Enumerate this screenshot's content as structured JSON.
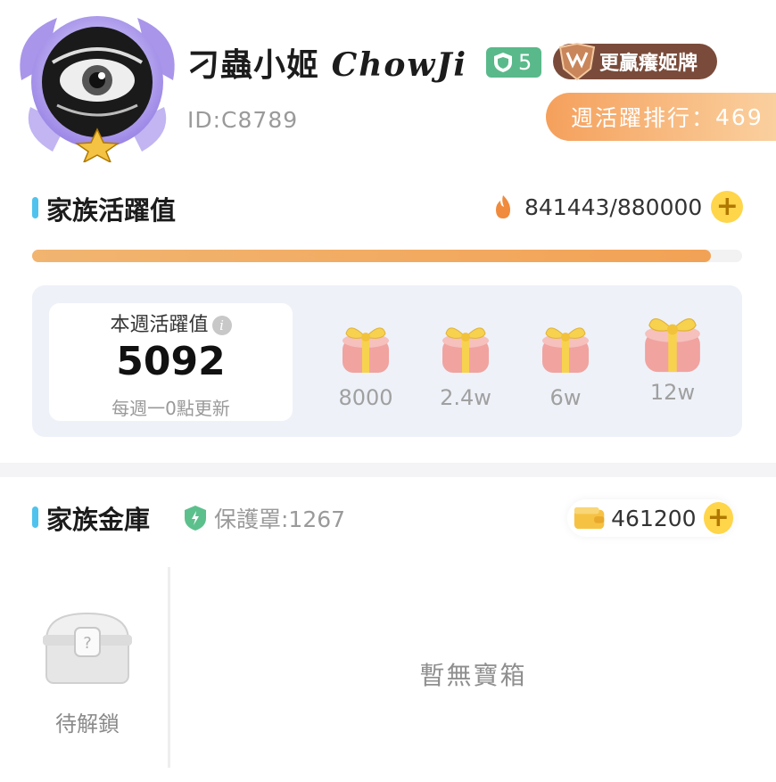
{
  "header": {
    "family_name": "刁蟲小姬",
    "family_name_script": "ChowJi",
    "level": "5",
    "title_badge": "更贏癢姬牌",
    "id_text": "ID:C8789",
    "weekly_rank_label": "週活躍排行：",
    "weekly_rank_value": "469"
  },
  "activity": {
    "section_title": "家族活躍值",
    "current": "841443/880000",
    "progress_fraction": 0.956,
    "weekly_label": "本週活躍值",
    "weekly_value": "5092",
    "weekly_note": "每週一0點更新",
    "rewards": [
      {
        "label": "8000"
      },
      {
        "label": "2.4w"
      },
      {
        "label": "6w"
      },
      {
        "label": "12w"
      }
    ]
  },
  "vault": {
    "section_title": "家族金庫",
    "shield_text": "保護罩:1267",
    "balance": "461200",
    "chest_label": "待解鎖",
    "empty_text": "暫無寶箱"
  },
  "colors": {
    "accent_bar": "#4fc3ee",
    "rank_gradient_start": "#f5a05c",
    "progress": "#f2a255",
    "level_badge": "#59b98a",
    "plus_button": "#ffd54a"
  },
  "icons": [
    "avatar-emblem",
    "level-shield-icon",
    "medal-icon",
    "fire-icon",
    "plus-icon",
    "info-icon",
    "gift-box-icon",
    "shield-check-icon",
    "wallet-icon",
    "chest-icon"
  ]
}
